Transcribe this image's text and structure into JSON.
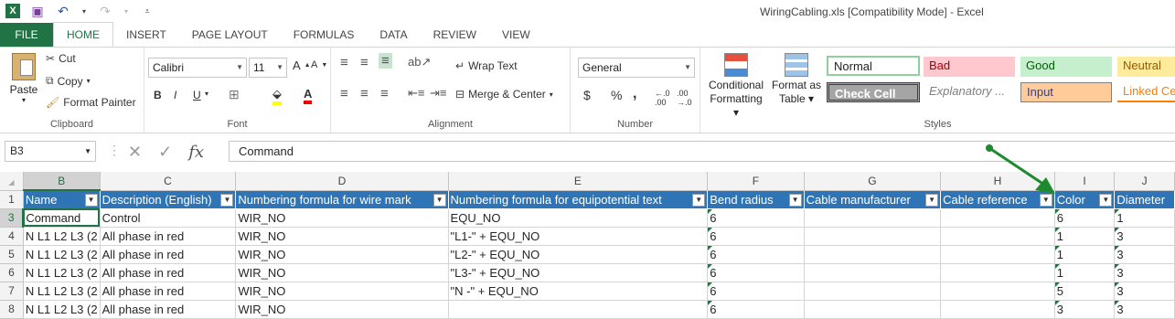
{
  "title": "WiringCabling.xls  [Compatibility Mode] - Excel",
  "tabs": [
    "FILE",
    "HOME",
    "INSERT",
    "PAGE LAYOUT",
    "FORMULAS",
    "DATA",
    "REVIEW",
    "VIEW"
  ],
  "ribbon": {
    "clipboard": {
      "paste": "Paste",
      "cut": "Cut",
      "copy": "Copy",
      "format_painter": "Format Painter",
      "label": "Clipboard"
    },
    "font": {
      "name": "Calibri",
      "size": "11",
      "bold": "B",
      "italic": "I",
      "underline": "U",
      "label": "Font"
    },
    "alignment": {
      "wrap": "Wrap Text",
      "merge": "Merge & Center",
      "label": "Alignment"
    },
    "number": {
      "format": "General",
      "currency": "$",
      "percent": "%",
      "comma": ",",
      "label": "Number"
    },
    "styles_group": {
      "conditional": "Conditional",
      "conditional2": "Formatting",
      "format_as": "Format as",
      "table": "Table",
      "normal": "Normal",
      "bad": "Bad",
      "good": "Good",
      "neutral": "Neutral",
      "check": "Check Cell",
      "explanatory": "Explanatory ...",
      "input": "Input",
      "linked": "Linked Ce",
      "label": "Styles"
    }
  },
  "formula_bar": {
    "name_box": "B3",
    "fx": "fx",
    "value": "Command"
  },
  "colors": {
    "accent": "#217346",
    "header_fill": "#2f75b5",
    "arrow": "#1e8a2e"
  },
  "columns": [
    "B",
    "C",
    "D",
    "E",
    "F",
    "G",
    "H",
    "I",
    "J"
  ],
  "rows": [
    {
      "num": "1",
      "cells": [
        "Name",
        "Description (English)",
        "Numbering formula for wire mark",
        "Numbering formula for equipotential text",
        "Bend radius",
        "Cable manufacturer",
        "Cable reference",
        "Color",
        "Diameter"
      ]
    },
    {
      "num": "3",
      "cells": [
        "Command",
        "Control",
        "WIR_NO",
        "EQU_NO",
        "6",
        "",
        "",
        "6",
        "1"
      ]
    },
    {
      "num": "4",
      "cells": [
        "N L1 L2 L3 (2",
        "All phase in red",
        "WIR_NO",
        "\"L1-\" + EQU_NO",
        "6",
        "",
        "",
        "1",
        "3"
      ]
    },
    {
      "num": "5",
      "cells": [
        "N L1 L2 L3 (2",
        "All phase in red",
        "WIR_NO",
        "\"L2-\" + EQU_NO",
        "6",
        "",
        "",
        "1",
        "3"
      ]
    },
    {
      "num": "6",
      "cells": [
        "N L1 L2 L3 (2",
        "All phase in red",
        "WIR_NO",
        "\"L3-\" + EQU_NO",
        "6",
        "",
        "",
        "1",
        "3"
      ]
    },
    {
      "num": "7",
      "cells": [
        "N L1 L2 L3 (2",
        "All phase in red",
        "WIR_NO",
        "\"N -\" + EQU_NO",
        "6",
        "",
        "",
        "5",
        "3"
      ]
    },
    {
      "num": "8",
      "cells": [
        "N L1 L2 L3 (2",
        "All phase in red",
        "WIR_NO",
        "",
        "6",
        "",
        "",
        "3",
        "3"
      ]
    }
  ]
}
